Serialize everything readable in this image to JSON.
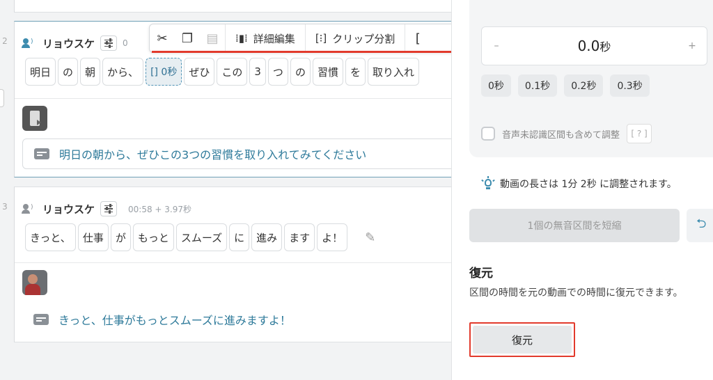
{
  "editor": {
    "row1": {
      "speaker": "リョウスケ",
      "time_fragment": "0",
      "edge_number": "2",
      "words": [
        "明日",
        "の",
        "朝",
        "から、",
        "[] 0秒",
        "ぜひ",
        "この",
        "3",
        "つ",
        "の",
        "習慣",
        "を",
        "取り入れ"
      ],
      "subtitle": "明日の朝から、ぜひこの3つの習慣を取り入れてみてください"
    },
    "row2": {
      "speaker": "リョウスケ",
      "time": "00:58 + 3.97秒",
      "edge_number": "3",
      "words": [
        "きっと、",
        "仕事",
        "が",
        "もっと",
        "スムーズ",
        "に",
        "進み",
        "ます",
        "よ！"
      ],
      "subtitle": "きっと、仕事がもっとスムーズに進みますよ！"
    },
    "toolbar": {
      "detail_edit": "詳細編集",
      "clip_split": "クリップ分割"
    }
  },
  "panel": {
    "stepper": {
      "minus": "–",
      "value": "0.0",
      "unit": "秒",
      "plus": "+"
    },
    "presets": [
      "0秒",
      "0.1秒",
      "0.2秒",
      "0.3秒"
    ],
    "include_unrecognized_label": "音声未認識区間も含めて調整",
    "help_label": "[ ? ]",
    "info_text": "動画の長さは 1分 2秒 に調整されます。",
    "shorten_button": "1個の無音区間を短縮",
    "restore": {
      "title": "復元",
      "description": "区間の時間を元の動画での時間に復元できます。",
      "button": "復元"
    }
  },
  "colors": {
    "accent": "#3d8cae",
    "subtitle_text": "#2e7a9a",
    "highlight_red": "#e23a2c",
    "selected_border": "#6f9fb6"
  },
  "icons": [
    "scissors-icon",
    "copy-icon",
    "paste-icon",
    "detail-edit-icon",
    "clip-split-icon",
    "speaker-icon",
    "adjust-icon",
    "pencil-icon",
    "subtitle-icon",
    "bulb-icon",
    "undo-icon"
  ]
}
